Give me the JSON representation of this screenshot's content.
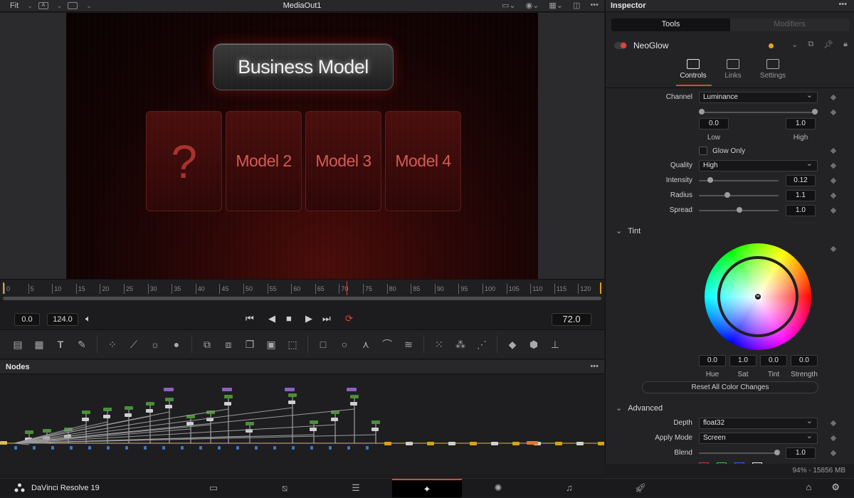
{
  "viewer": {
    "fit_label": "Fit",
    "title": "MediaOut1",
    "left_icon_label": "A",
    "right_menu": "•••",
    "canvas": {
      "title": "Business Model",
      "cards": [
        "?",
        "Model 2",
        "Model 3",
        "Model 4"
      ]
    }
  },
  "ruler": {
    "ticks": [
      "0",
      "5",
      "10",
      "15",
      "20",
      "25",
      "30",
      "35",
      "40",
      "45",
      "50",
      "55",
      "60",
      "65",
      "70",
      "75",
      "80",
      "85",
      "90",
      "95",
      "100",
      "105",
      "110",
      "115",
      "120"
    ]
  },
  "transport": {
    "start": "0.0",
    "end": "124.0",
    "current_frame": "72.0"
  },
  "nodes": {
    "title": "Nodes",
    "menu": "•••"
  },
  "inspector": {
    "title": "Inspector",
    "menu": "•••",
    "tabs": [
      "Tools",
      "Modifiers"
    ],
    "tool_name": "NeoGlow",
    "subtabs": [
      "Controls",
      "Links",
      "Settings"
    ],
    "channel": {
      "label": "Channel",
      "value": "Luminance"
    },
    "low_high": {
      "low_value": "0.0",
      "high_value": "1.0",
      "low_label": "Low",
      "high_label": "High"
    },
    "glow_only": "Glow Only",
    "quality": {
      "label": "Quality",
      "value": "High"
    },
    "intensity": {
      "label": "Intensity",
      "value": "0.12"
    },
    "radius": {
      "label": "Radius",
      "value": "1.1"
    },
    "spread": {
      "label": "Spread",
      "value": "1.0"
    },
    "tint_section": "Tint",
    "color": {
      "values": [
        "0.0",
        "1.0",
        "0.0",
        "0.0"
      ],
      "labels": [
        "Hue",
        "Sat",
        "Tint",
        "Strength"
      ],
      "wheel_marker": "M"
    },
    "reset_label": "Reset All Color Changes",
    "advanced_section": "Advanced",
    "depth": {
      "label": "Depth",
      "value": "float32"
    },
    "apply_mode": {
      "label": "Apply Mode",
      "value": "Screen"
    },
    "blend": {
      "label": "Blend",
      "value": "1.0"
    }
  },
  "status": {
    "text": "94% - 15856 MB"
  },
  "bottom": {
    "app_name": "DaVinci Resolve 19",
    "pages": [
      "media-icon",
      "cut-icon",
      "edit-icon",
      "fusion-icon",
      "color-icon",
      "fairlight-icon",
      "deliver-icon"
    ],
    "active_page": "fusion-icon"
  },
  "colors": {
    "accent_red": "#e0433a",
    "accent_orange": "#e8a31f",
    "timeline_end": "#d7a21c"
  }
}
